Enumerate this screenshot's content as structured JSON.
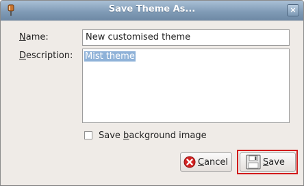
{
  "window": {
    "title": "Save Theme As...",
    "close_glyph": "×"
  },
  "form": {
    "name_label_mnemonic": "N",
    "name_label_rest": "ame:",
    "name_value": "New customised theme",
    "description_label_mnemonic": "D",
    "description_label_rest": "escription:",
    "description_value": "Mist theme"
  },
  "checkbox": {
    "label_before": "Save ",
    "label_mnemonic": "b",
    "label_after": "ackground image",
    "checked": false
  },
  "buttons": {
    "cancel_mnemonic": "C",
    "cancel_rest": "ancel",
    "save_mnemonic": "S",
    "save_rest": "ave"
  },
  "colors": {
    "titlebar": "#7f9ab5",
    "selection": "#8fb2d8",
    "highlight_box": "#d11a1a",
    "cancel_icon": "#d32222"
  },
  "icons": {
    "window_menu": "pin-icon",
    "close": "close-icon",
    "cancel": "cancel-icon",
    "save": "floppy-disk-icon"
  }
}
